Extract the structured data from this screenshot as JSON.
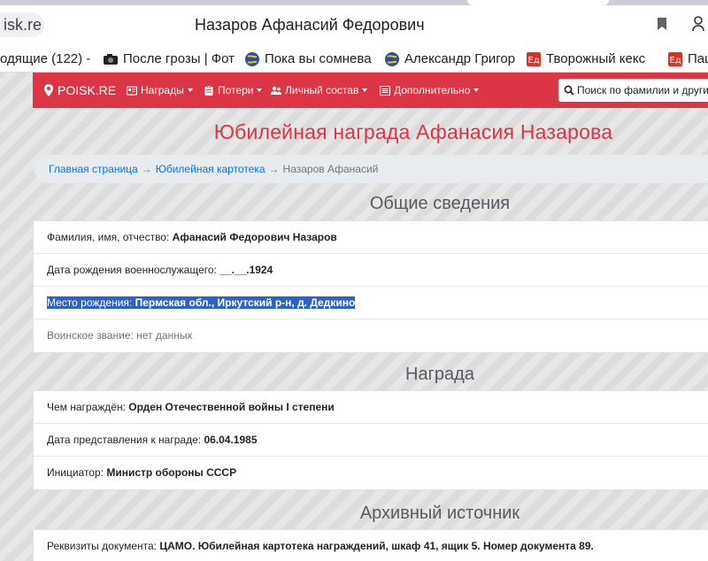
{
  "browser": {
    "address_text": "isk.re",
    "page_title": "Назаров Афанасий Федорович",
    "bookmarks": [
      {
        "label": "одящие (122) -",
        "icon": "mail-icon"
      },
      {
        "label": "После грозы | Фот",
        "icon": "camera-icon"
      },
      {
        "label": "Пока вы сомнева",
        "icon": "globe-icon"
      },
      {
        "label": "Александр Григор",
        "icon": "globe-icon"
      },
      {
        "label": "Творожный кекс",
        "icon": "recipe-icon"
      },
      {
        "label": "Паш",
        "icon": "recipe-icon"
      }
    ]
  },
  "nav": {
    "brand": "POISK.RE",
    "items": [
      {
        "label": "Награды",
        "icon": "id-card-icon"
      },
      {
        "label": "Потери",
        "icon": "clipboard-icon"
      },
      {
        "label": "Личный состав",
        "icon": "users-icon"
      },
      {
        "label": "Дополнительно",
        "icon": "list-icon"
      }
    ],
    "search_placeholder": "Поиск по фамилии и други"
  },
  "page": {
    "title": "Юбилейная награда Афанасия Назарова",
    "breadcrumb": {
      "home": "Главная страница",
      "arrow": "→",
      "catalog": "Юбилейная картотека",
      "current": "Назаров Афанасий"
    }
  },
  "general": {
    "heading": "Общие сведения",
    "rows": [
      {
        "label": "Фамилия, имя, отчество:",
        "value": "Афанасий Федорович Назаров"
      },
      {
        "label": "Дата рождения военнослужащего:",
        "value": "__.__.1924"
      },
      {
        "label": "Место рождения:",
        "value": "Пермская обл., Иркутский р-н, д. Дедкино"
      },
      {
        "label": "Воинское звание:",
        "value": "нет данных"
      }
    ]
  },
  "award": {
    "heading": "Награда",
    "rows": [
      {
        "label": "Чем награждён:",
        "value": "Орден Отечественной войны I степени"
      },
      {
        "label": "Дата представления к награде:",
        "value": "06.04.1985"
      },
      {
        "label": "Инициатор:",
        "value": "Министр обороны СССР"
      }
    ]
  },
  "archive": {
    "heading": "Архивный источник",
    "rows": [
      {
        "label": "Реквизиты документа:",
        "value": "ЦАМО. Юбилейная картотека награждений, шкаф 41, ящик 5. Номер документа 89."
      }
    ]
  },
  "colors": {
    "navbar": "#dc3545",
    "title": "#dc3545",
    "link": "#0d6efd",
    "selection": "#2f62c9"
  }
}
